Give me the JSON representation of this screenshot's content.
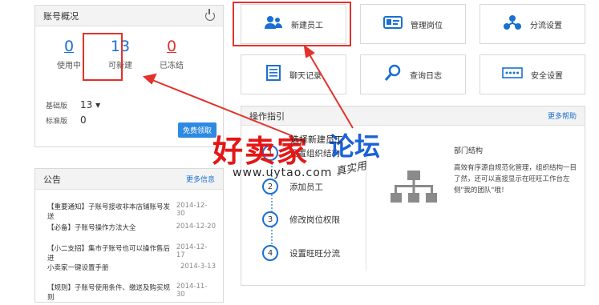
{
  "account": {
    "title": "账号概况",
    "stats": [
      {
        "value": "0",
        "label": "使用中"
      },
      {
        "value": "13",
        "label": "可新建"
      },
      {
        "value": "0",
        "label": "已冻结"
      }
    ],
    "basic_label": "基础版",
    "basic_value": "13 ▾",
    "standard_label": "标准版",
    "standard_value": "0",
    "free_button": "免费领取"
  },
  "notice": {
    "title": "公告",
    "more": "更多信息",
    "items": [
      {
        "text": "【重要通知】子账号接收非本店铺账号发送",
        "date": "2014-12-30"
      },
      {
        "text": "【必备】子账号操作方法大全",
        "date": "2014-12-20"
      },
      {
        "text": "【小二支招】集市子账号也可以操作售后进",
        "date": "2014-12-17"
      },
      {
        "text": "小卖家一键设置手册",
        "date": "2014-3-13"
      },
      {
        "text": "【规则】子账号使用条件、缴送及购买规则",
        "date": "2014-11-30"
      }
    ]
  },
  "tiles": [
    {
      "label": "新建员工",
      "icon": "users-icon"
    },
    {
      "label": "管理岗位",
      "icon": "id-card-icon"
    },
    {
      "label": "分流设置",
      "icon": "flow-icon"
    },
    {
      "label": "聊天记录",
      "icon": "document-icon"
    },
    {
      "label": "查询日志",
      "icon": "search-icon"
    },
    {
      "label": "安全设置",
      "icon": "password-icon"
    }
  ],
  "guide": {
    "title": "操作指引",
    "more": "更多帮助",
    "steps": [
      {
        "num": "1",
        "label": "设置组织结构"
      },
      {
        "num": "2",
        "label": "添加员工"
      },
      {
        "num": "3",
        "label": "修改岗位权限"
      },
      {
        "num": "4",
        "label": "设置旺旺分流"
      }
    ],
    "right_title": "部门结构",
    "right_desc": "高效有序源自规范化管理，组织结构一目了然，还可以直接显示在旺旺工作台左侧\"我的团队\"哦！"
  },
  "annotation": {
    "select_text": "选择新建员工"
  },
  "watermark": {
    "main": "好卖家",
    "forum": "论坛",
    "url": "www.uytao.com",
    "handwriting": "真实用"
  }
}
